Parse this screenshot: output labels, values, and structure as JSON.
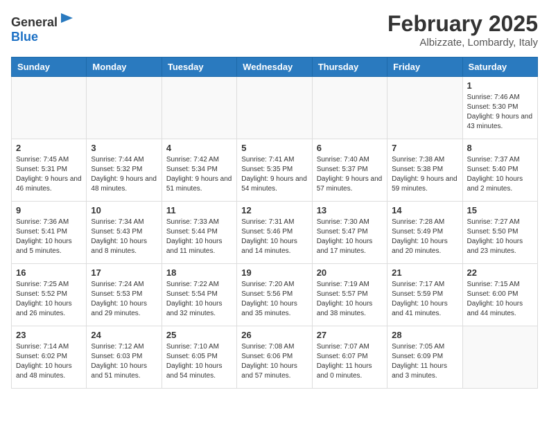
{
  "logo": {
    "general": "General",
    "blue": "Blue"
  },
  "header": {
    "month": "February 2025",
    "location": "Albizzate, Lombardy, Italy"
  },
  "weekdays": [
    "Sunday",
    "Monday",
    "Tuesday",
    "Wednesday",
    "Thursday",
    "Friday",
    "Saturday"
  ],
  "weeks": [
    [
      {
        "day": "",
        "info": ""
      },
      {
        "day": "",
        "info": ""
      },
      {
        "day": "",
        "info": ""
      },
      {
        "day": "",
        "info": ""
      },
      {
        "day": "",
        "info": ""
      },
      {
        "day": "",
        "info": ""
      },
      {
        "day": "1",
        "info": "Sunrise: 7:46 AM\nSunset: 5:30 PM\nDaylight: 9 hours and 43 minutes."
      }
    ],
    [
      {
        "day": "2",
        "info": "Sunrise: 7:45 AM\nSunset: 5:31 PM\nDaylight: 9 hours and 46 minutes."
      },
      {
        "day": "3",
        "info": "Sunrise: 7:44 AM\nSunset: 5:32 PM\nDaylight: 9 hours and 48 minutes."
      },
      {
        "day": "4",
        "info": "Sunrise: 7:42 AM\nSunset: 5:34 PM\nDaylight: 9 hours and 51 minutes."
      },
      {
        "day": "5",
        "info": "Sunrise: 7:41 AM\nSunset: 5:35 PM\nDaylight: 9 hours and 54 minutes."
      },
      {
        "day": "6",
        "info": "Sunrise: 7:40 AM\nSunset: 5:37 PM\nDaylight: 9 hours and 57 minutes."
      },
      {
        "day": "7",
        "info": "Sunrise: 7:38 AM\nSunset: 5:38 PM\nDaylight: 9 hours and 59 minutes."
      },
      {
        "day": "8",
        "info": "Sunrise: 7:37 AM\nSunset: 5:40 PM\nDaylight: 10 hours and 2 minutes."
      }
    ],
    [
      {
        "day": "9",
        "info": "Sunrise: 7:36 AM\nSunset: 5:41 PM\nDaylight: 10 hours and 5 minutes."
      },
      {
        "day": "10",
        "info": "Sunrise: 7:34 AM\nSunset: 5:43 PM\nDaylight: 10 hours and 8 minutes."
      },
      {
        "day": "11",
        "info": "Sunrise: 7:33 AM\nSunset: 5:44 PM\nDaylight: 10 hours and 11 minutes."
      },
      {
        "day": "12",
        "info": "Sunrise: 7:31 AM\nSunset: 5:46 PM\nDaylight: 10 hours and 14 minutes."
      },
      {
        "day": "13",
        "info": "Sunrise: 7:30 AM\nSunset: 5:47 PM\nDaylight: 10 hours and 17 minutes."
      },
      {
        "day": "14",
        "info": "Sunrise: 7:28 AM\nSunset: 5:49 PM\nDaylight: 10 hours and 20 minutes."
      },
      {
        "day": "15",
        "info": "Sunrise: 7:27 AM\nSunset: 5:50 PM\nDaylight: 10 hours and 23 minutes."
      }
    ],
    [
      {
        "day": "16",
        "info": "Sunrise: 7:25 AM\nSunset: 5:52 PM\nDaylight: 10 hours and 26 minutes."
      },
      {
        "day": "17",
        "info": "Sunrise: 7:24 AM\nSunset: 5:53 PM\nDaylight: 10 hours and 29 minutes."
      },
      {
        "day": "18",
        "info": "Sunrise: 7:22 AM\nSunset: 5:54 PM\nDaylight: 10 hours and 32 minutes."
      },
      {
        "day": "19",
        "info": "Sunrise: 7:20 AM\nSunset: 5:56 PM\nDaylight: 10 hours and 35 minutes."
      },
      {
        "day": "20",
        "info": "Sunrise: 7:19 AM\nSunset: 5:57 PM\nDaylight: 10 hours and 38 minutes."
      },
      {
        "day": "21",
        "info": "Sunrise: 7:17 AM\nSunset: 5:59 PM\nDaylight: 10 hours and 41 minutes."
      },
      {
        "day": "22",
        "info": "Sunrise: 7:15 AM\nSunset: 6:00 PM\nDaylight: 10 hours and 44 minutes."
      }
    ],
    [
      {
        "day": "23",
        "info": "Sunrise: 7:14 AM\nSunset: 6:02 PM\nDaylight: 10 hours and 48 minutes."
      },
      {
        "day": "24",
        "info": "Sunrise: 7:12 AM\nSunset: 6:03 PM\nDaylight: 10 hours and 51 minutes."
      },
      {
        "day": "25",
        "info": "Sunrise: 7:10 AM\nSunset: 6:05 PM\nDaylight: 10 hours and 54 minutes."
      },
      {
        "day": "26",
        "info": "Sunrise: 7:08 AM\nSunset: 6:06 PM\nDaylight: 10 hours and 57 minutes."
      },
      {
        "day": "27",
        "info": "Sunrise: 7:07 AM\nSunset: 6:07 PM\nDaylight: 11 hours and 0 minutes."
      },
      {
        "day": "28",
        "info": "Sunrise: 7:05 AM\nSunset: 6:09 PM\nDaylight: 11 hours and 3 minutes."
      },
      {
        "day": "",
        "info": ""
      }
    ]
  ]
}
